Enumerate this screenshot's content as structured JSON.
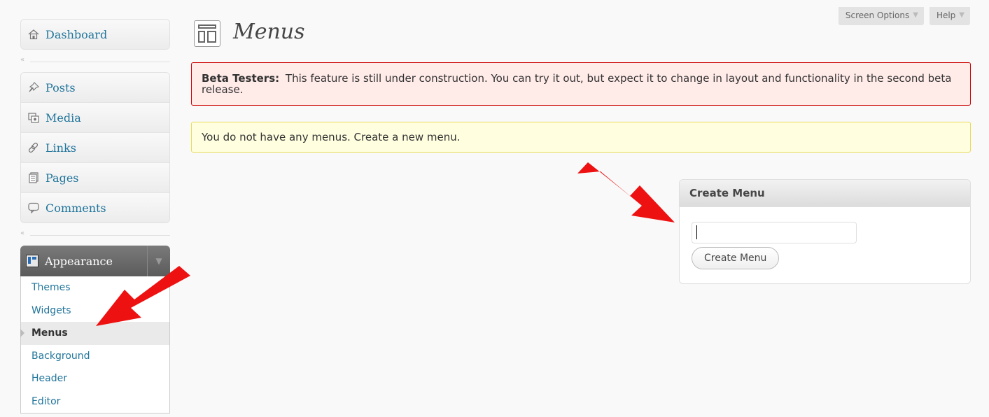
{
  "header": {
    "screen_options": "Screen Options",
    "help": "Help",
    "title": "Menus"
  },
  "sidebar": {
    "dashboard": {
      "label": "Dashboard",
      "icon": "home-icon"
    },
    "items": [
      {
        "label": "Posts",
        "icon": "pushpin-icon"
      },
      {
        "label": "Media",
        "icon": "media-icon"
      },
      {
        "label": "Links",
        "icon": "chain-link-icon"
      },
      {
        "label": "Pages",
        "icon": "pages-icon"
      },
      {
        "label": "Comments",
        "icon": "speech-bubble-icon"
      }
    ],
    "appearance": {
      "label": "Appearance",
      "submenu": [
        "Themes",
        "Widgets",
        "Menus",
        "Background",
        "Header",
        "Editor"
      ],
      "current": "Menus"
    }
  },
  "notices": {
    "error_label": "Beta Testers:",
    "error_text": "This feature is still under construction. You can try it out, but expect it to change in layout and functionality in the second beta release.",
    "update_text": "You do not have any menus. Create a new menu."
  },
  "create_menu": {
    "title": "Create Menu",
    "input_value": "",
    "button_label": "Create Menu"
  },
  "colors": {
    "link": "#21759b",
    "error_bg": "#ffebe8",
    "error_border": "#cc0000",
    "update_bg": "#ffffe0",
    "update_border": "#e6db55",
    "arrow": "#ee1111"
  }
}
